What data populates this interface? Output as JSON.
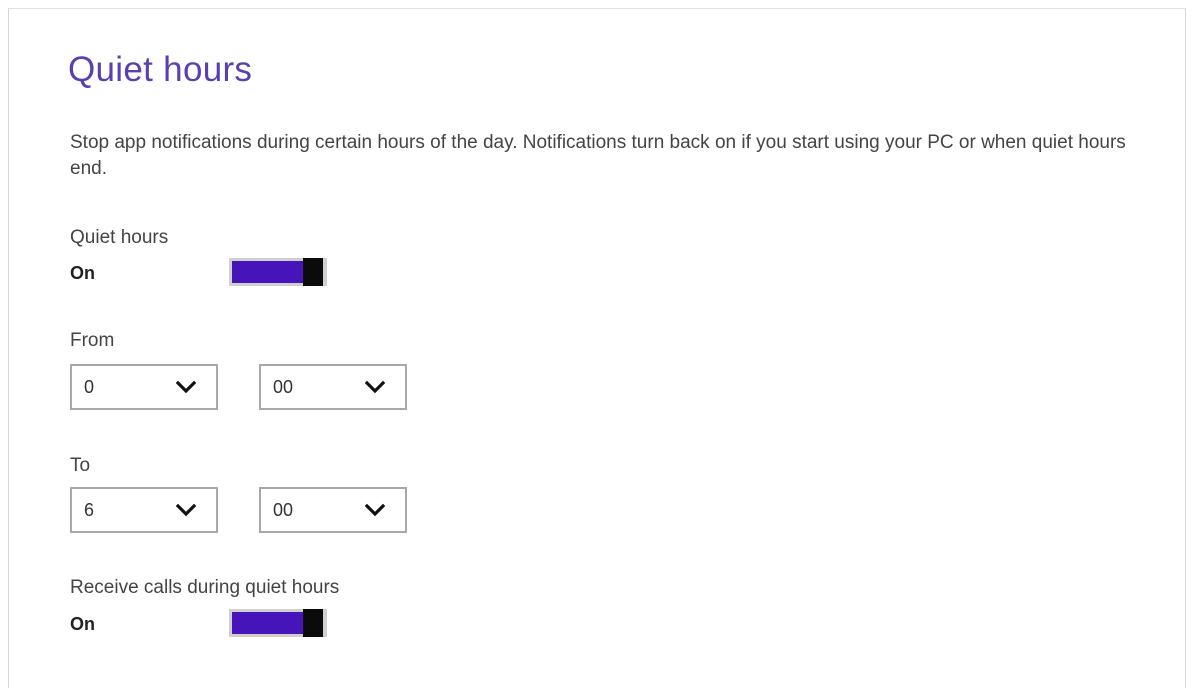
{
  "page": {
    "title": "Quiet hours",
    "description": "Stop app notifications during certain hours of the day. Notifications turn back on if you start using your PC or when quiet hours end."
  },
  "quiet_hours": {
    "label": "Quiet hours",
    "state": "On",
    "enabled": true
  },
  "from": {
    "label": "From",
    "hour": "0",
    "minute": "00"
  },
  "to": {
    "label": "To",
    "hour": "6",
    "minute": "00"
  },
  "receive_calls": {
    "label": "Receive calls during quiet hours",
    "state": "On",
    "enabled": true
  },
  "icons": {
    "dropdown": "chevron-down-icon"
  },
  "colors": {
    "title": "#5b3fb0",
    "toggle_on": "#4614b8",
    "toggle_thumb": "#0b0b0b",
    "border": "#a8a8a8"
  }
}
